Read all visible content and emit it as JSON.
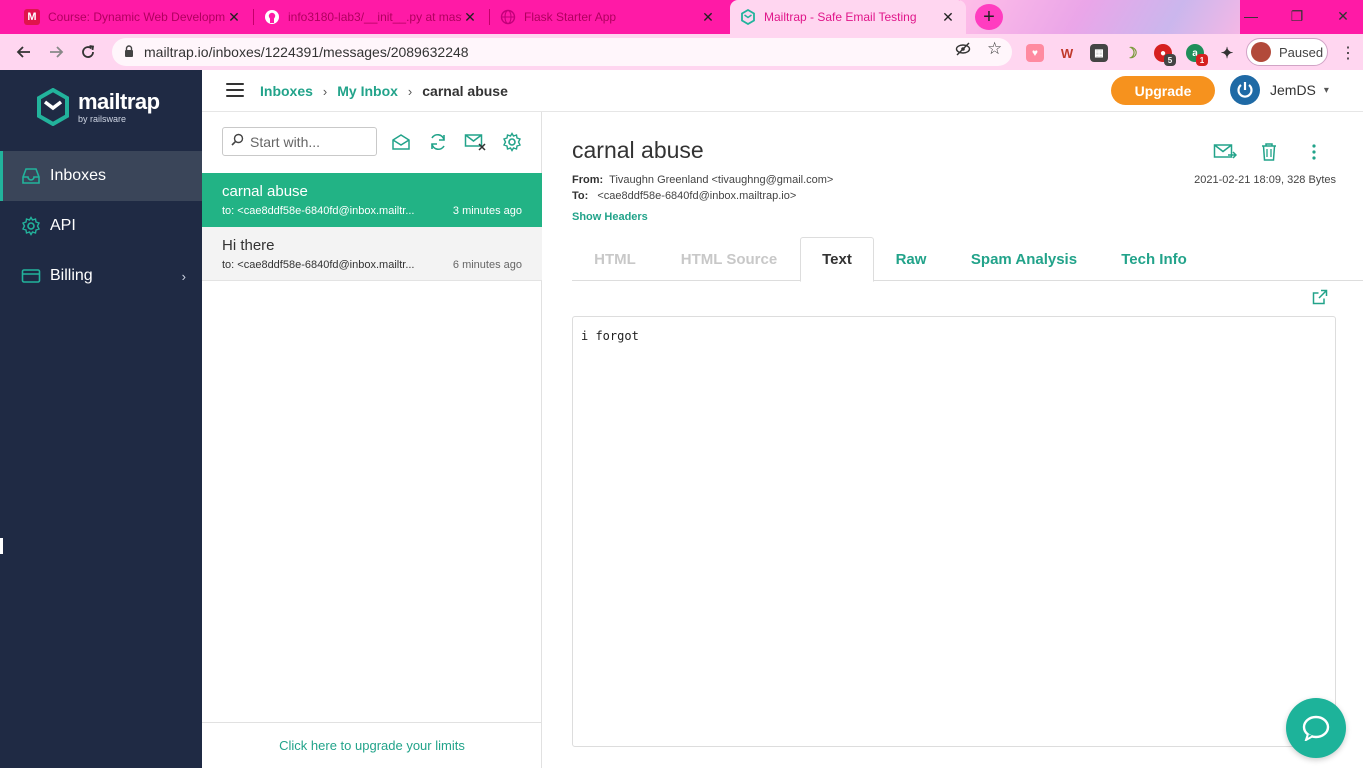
{
  "browser": {
    "tabs": [
      {
        "title": "Course: Dynamic Web Developm",
        "favicon": "M"
      },
      {
        "title": "info3180-lab3/__init__.py at mast",
        "favicon": "github-icon"
      },
      {
        "title": "Flask Starter App",
        "favicon": "globe-icon"
      },
      {
        "title": "Mailtrap - Safe Email Testing",
        "favicon": "mailtrap-icon"
      }
    ],
    "url": "mailtrap.io/inboxes/1224391/messages/2089632248",
    "profile_status": "Paused",
    "extension_badges": {
      "first": "5",
      "second": "1"
    },
    "colors": {
      "tabbar": "#ff1aa6",
      "active_tab": "#ffd6f0"
    }
  },
  "brand": {
    "name": "mailtrap",
    "sub": "by railsware"
  },
  "sidebar": {
    "items": [
      {
        "label": "Inboxes",
        "icon": "inbox-icon"
      },
      {
        "label": "API",
        "icon": "gear-icon"
      },
      {
        "label": "Billing",
        "icon": "card-icon"
      }
    ]
  },
  "topbar": {
    "breadcrumb": [
      "Inboxes",
      "My Inbox",
      "carnal abuse"
    ],
    "upgrade_label": "Upgrade",
    "user": "JemDS"
  },
  "list": {
    "search_placeholder": "Start with...",
    "messages": [
      {
        "subject": "carnal abuse",
        "to": "to: <cae8ddf58e-6840fd@inbox.mailtrap.io>",
        "to_shown": "to: <cae8ddf58e-6840fd@inbox.mailtr...",
        "age": "3 minutes ago"
      },
      {
        "subject": "Hi there",
        "to": "to: <cae8ddf58e-6840fd@inbox.mailtrap.io>",
        "to_shown": "to: <cae8ddf58e-6840fd@inbox.mailtr...",
        "age": "6 minutes ago"
      }
    ],
    "upgrade_limits": "Click here to upgrade your limits"
  },
  "message": {
    "subject": "carnal abuse",
    "from_label": "From:",
    "from": "Tivaughn Greenland <tivaughng@gmail.com>",
    "to_label": "To:",
    "to": "<cae8ddf58e-6840fd@inbox.mailtrap.io>",
    "date_size": "2021-02-21 18:09, 328 Bytes",
    "show_headers": "Show Headers",
    "tabs": [
      "HTML",
      "HTML Source",
      "Text",
      "Raw",
      "Spam Analysis",
      "Tech Info"
    ],
    "body": "i forgot"
  },
  "colors": {
    "accent": "#22b385",
    "sidebar": "#1f2a44",
    "upgrade": "#f6921e"
  }
}
